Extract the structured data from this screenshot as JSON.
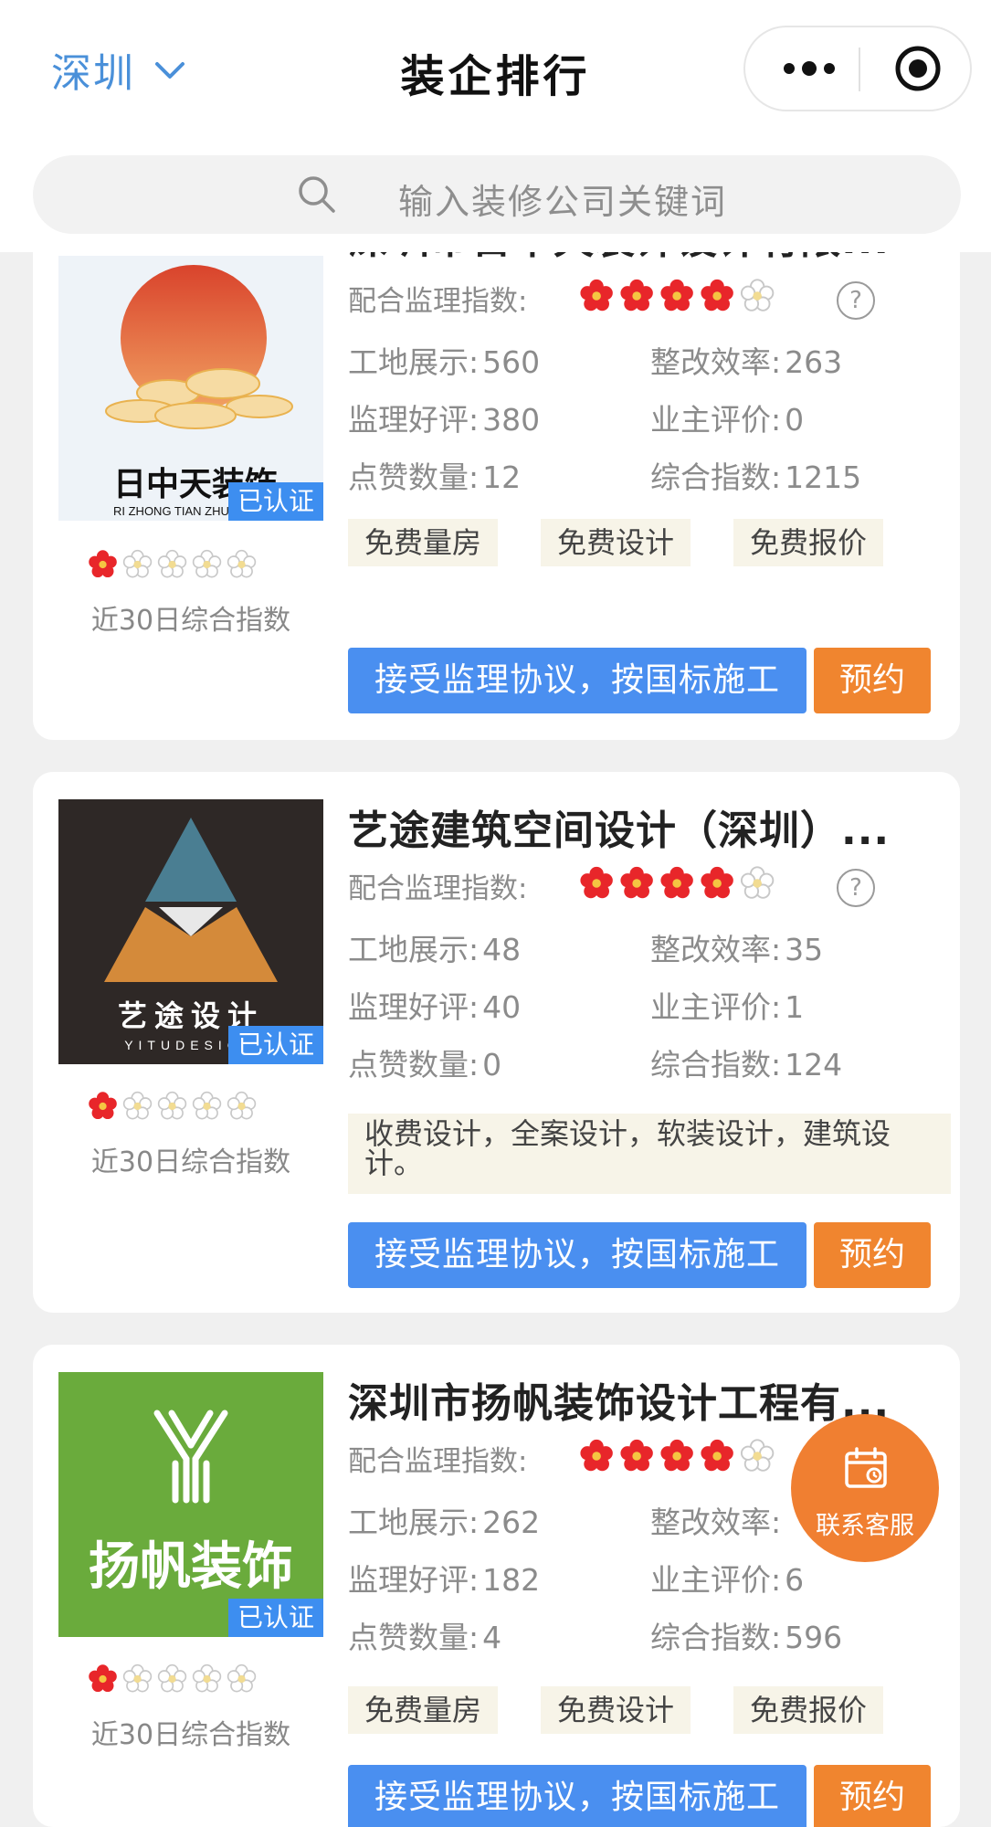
{
  "header": {
    "city": "深圳",
    "title": "装企排行",
    "search_placeholder": "输入装修公司关键词"
  },
  "colors": {
    "accent_blue": "#4a8ff0",
    "accent_orange": "#f0852f",
    "flower_red": "#e8262a",
    "tag_bg": "#f7f4e8"
  },
  "labels": {
    "verified": "已认证",
    "index_note": "近30日综合指数",
    "coop_index": "配合监理指数:",
    "site_show": "工地展示:",
    "rectify": "整改效率:",
    "supervision_good": "监理好评:",
    "owner_review": "业主评价:",
    "likes": "点赞数量:",
    "composite": "综合指数:",
    "protocol_button": "接受监理协议，按国标施工",
    "book_button": "预约",
    "help": "?"
  },
  "companies": [
    {
      "name": "深圳市日中天装饰设计有限...",
      "logo_text": "日中天装饰",
      "logo_subtext": "RI ZHONG TIAN ZHUANGSHI",
      "logo_rating": 1.5,
      "coop_rating": 4,
      "site_show": "560",
      "rectify": "263",
      "supervision_good": "380",
      "owner_review": "0",
      "likes": "12",
      "composite": "1215",
      "tags": [
        "免费量房",
        "免费设计",
        "免费报价"
      ]
    },
    {
      "name": "艺途建筑空间设计（深圳）...",
      "logo_text": "艺途设计",
      "logo_subtext": "YITUDESIGN",
      "logo_rating": 1,
      "coop_rating": 4,
      "site_show": "48",
      "rectify": "35",
      "supervision_good": "40",
      "owner_review": "1",
      "likes": "0",
      "composite": "124",
      "tag_long": "收费设计，全案设计，软装设计，建筑设计。"
    },
    {
      "name": "深圳市扬帆装饰设计工程有...",
      "logo_text": "扬帆装饰",
      "logo_rating": 1,
      "coop_rating": 4,
      "site_show": "262",
      "rectify": "",
      "supervision_good": "182",
      "owner_review": "6",
      "likes": "4",
      "composite": "596",
      "tags": [
        "免费量房",
        "免费设计",
        "免费报价"
      ]
    }
  ],
  "fab": {
    "label": "联系客服",
    "icon": "calendar-icon"
  }
}
